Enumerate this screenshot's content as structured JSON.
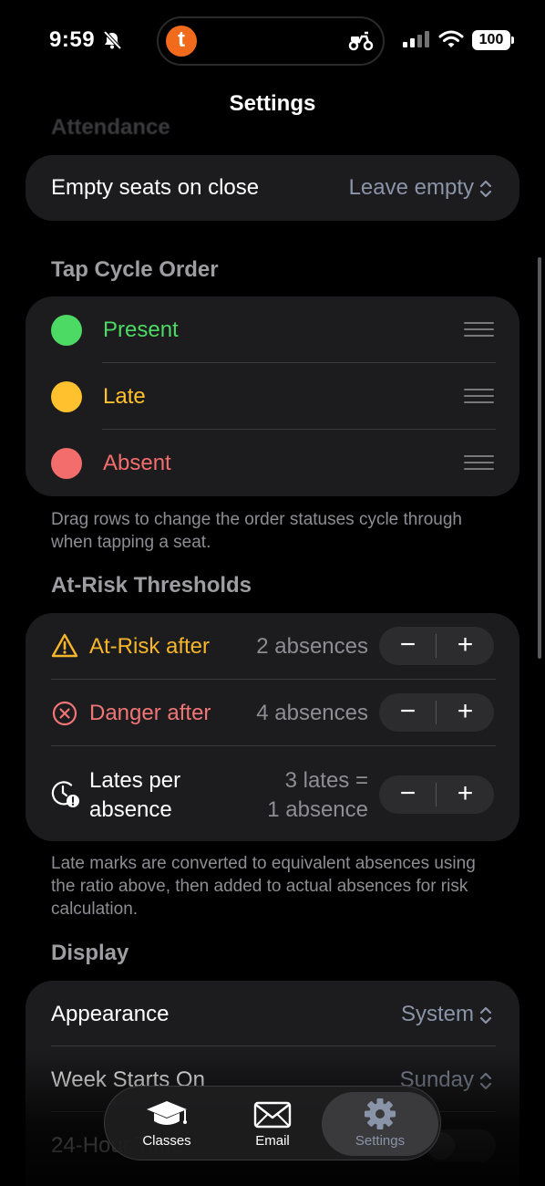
{
  "status_bar": {
    "time": "9:59",
    "battery": "100",
    "island_app_letter": "t"
  },
  "nav": {
    "title": "Settings"
  },
  "attendance": {
    "header": "Attendance",
    "empty_seats_label": "Empty seats on close",
    "empty_seats_value": "Leave empty"
  },
  "tap_cycle": {
    "header": "Tap Cycle Order",
    "items": [
      {
        "label": "Present",
        "color": "#4cd964"
      },
      {
        "label": "Late",
        "color": "#ffc12e"
      },
      {
        "label": "Absent",
        "color": "#f46d6d"
      }
    ],
    "footnote": "Drag rows to change the order statuses cycle through when tapping a seat."
  },
  "thresholds": {
    "header": "At-Risk Thresholds",
    "at_risk": {
      "label": "At-Risk after",
      "value": "2 absences",
      "color": "#f6b52b"
    },
    "danger": {
      "label": "Danger after",
      "value": "4 absences",
      "color": "#f07575"
    },
    "lates": {
      "label_line1": "Lates per",
      "label_line2": "absence",
      "value_line1": "3 lates =",
      "value_line2": "1 absence"
    },
    "minus": "−",
    "plus": "+",
    "footnote": "Late marks are converted to equivalent absences using the ratio above, then added to actual absences for risk calculation."
  },
  "display": {
    "header": "Display",
    "appearance_label": "Appearance",
    "appearance_value": "System",
    "week_label": "Week Starts On",
    "week_value": "Sunday",
    "hour_label": "24-Hour Time"
  },
  "tabbar": {
    "tabs": [
      {
        "label": "Classes",
        "icon": "graduation-cap-icon"
      },
      {
        "label": "Email",
        "icon": "envelope-icon"
      },
      {
        "label": "Settings",
        "icon": "gear-icon"
      }
    ]
  }
}
